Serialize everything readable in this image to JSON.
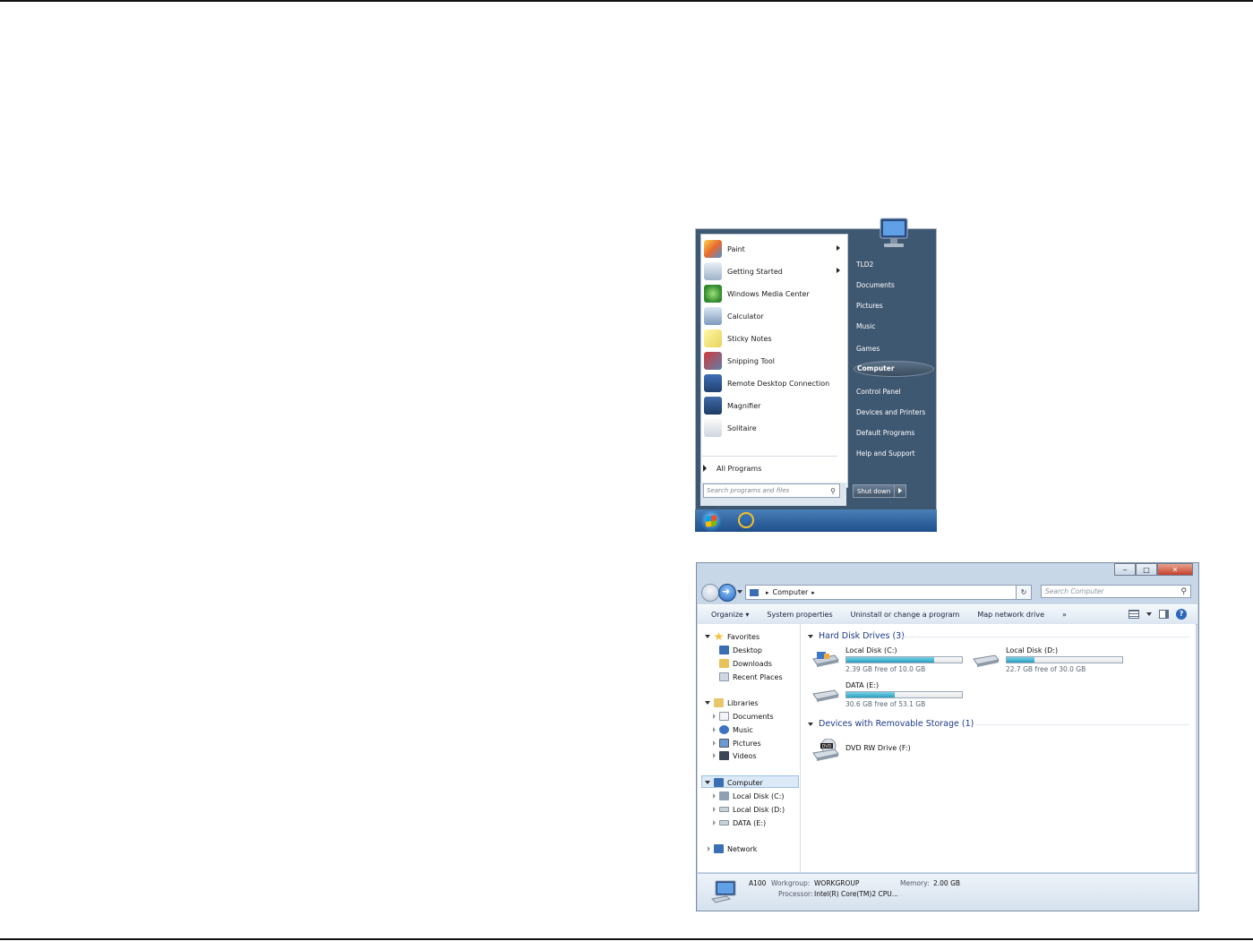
{
  "start_menu": {
    "programs": [
      {
        "label": "Paint",
        "icon": "paint-icon",
        "submenu": true
      },
      {
        "label": "Getting Started",
        "icon": "getting-started-icon",
        "submenu": true
      },
      {
        "label": "Windows Media Center",
        "icon": "media-center-icon",
        "submenu": false
      },
      {
        "label": "Calculator",
        "icon": "calculator-icon",
        "submenu": false
      },
      {
        "label": "Sticky Notes",
        "icon": "sticky-notes-icon",
        "submenu": false
      },
      {
        "label": "Snipping Tool",
        "icon": "snipping-tool-icon",
        "submenu": false
      },
      {
        "label": "Remote Desktop Connection",
        "icon": "remote-desktop-icon",
        "submenu": false
      },
      {
        "label": "Magnifier",
        "icon": "magnifier-icon",
        "submenu": false
      },
      {
        "label": "Solitaire",
        "icon": "solitaire-icon",
        "submenu": false
      }
    ],
    "all_programs": "All Programs",
    "search_placeholder": "Search programs and files",
    "right_items": [
      "TLD2",
      "Documents",
      "Pictures",
      "Music",
      "Games",
      "Computer",
      "Control Panel",
      "Devices and Printers",
      "Default Programs",
      "Help and Support"
    ],
    "highlighted": "Computer",
    "shutdown": "Shut down"
  },
  "explorer": {
    "address": "Computer",
    "search_placeholder": "Search Computer",
    "commands": [
      "Organize ▾",
      "System properties",
      "Uninstall or change a program",
      "Map network drive",
      "»"
    ],
    "nav": {
      "favorites": {
        "label": "Favorites",
        "items": [
          "Desktop",
          "Downloads",
          "Recent Places"
        ]
      },
      "libraries": {
        "label": "Libraries",
        "items": [
          "Documents",
          "Music",
          "Pictures",
          "Videos"
        ]
      },
      "computer": {
        "label": "Computer",
        "items": [
          "Local Disk (C:)",
          "Local Disk (D:)",
          "DATA (E:)"
        ]
      },
      "network": {
        "label": "Network"
      }
    },
    "groups": {
      "hdd": "Hard Disk Drives (3)",
      "removable": "Devices with Removable Storage (1)"
    },
    "drives": [
      {
        "name": "Local Disk (C:)",
        "free_text": "2.39 GB free of 10.0 GB",
        "used_fraction": 0.76
      },
      {
        "name": "Local Disk (D:)",
        "free_text": "22.7 GB free of 30.0 GB",
        "used_fraction": 0.24
      },
      {
        "name": "DATA (E:)",
        "free_text": "30.6 GB free of 53.1 GB",
        "used_fraction": 0.42
      }
    ],
    "removable": [
      {
        "name": "DVD RW Drive (F:)",
        "badge": "DVD"
      }
    ],
    "details": {
      "computer_name": "A100",
      "workgroup_label": "Workgroup:",
      "workgroup": "WORKGROUP",
      "memory_label": "Memory:",
      "memory": "2.00 GB",
      "processor_label": "Processor:",
      "processor": "Intel(R) Core(TM)2 CPU..."
    }
  }
}
